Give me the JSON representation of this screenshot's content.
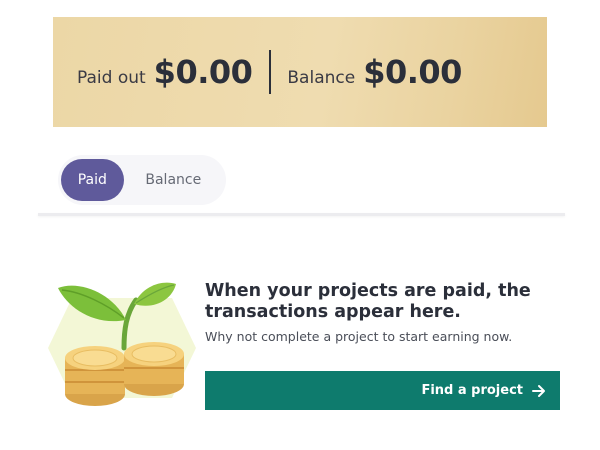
{
  "summary": {
    "paid_out_label": "Paid out",
    "paid_out_value": "$0.00",
    "balance_label": "Balance",
    "balance_value": "$0.00"
  },
  "tabs": [
    {
      "label": "Paid",
      "active": true
    },
    {
      "label": "Balance",
      "active": false
    }
  ],
  "empty_state": {
    "title": "When your projects are paid, the transactions appear here.",
    "subtitle": "Why not complete a project to start earning now.",
    "cta_label": "Find a project",
    "cta_icon": "arrow-right-icon",
    "illustration": "coins-sprout-illustration"
  },
  "colors": {
    "banner": "#ecd7a6",
    "tab_active": "#5f5a9b",
    "cta": "#0e7b6d"
  }
}
